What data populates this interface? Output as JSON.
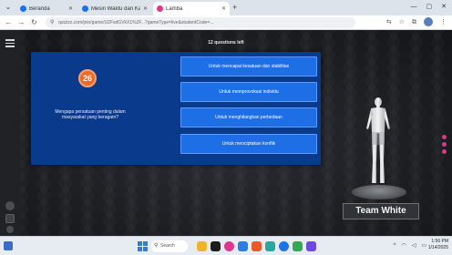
{
  "browser": {
    "tabs": [
      {
        "title": "Beranda",
        "favicon_color": "#1a73e8",
        "active": false
      },
      {
        "title": "Mesin Waktu dan Karang Dasar",
        "favicon_color": "#1a73e8",
        "active": false
      },
      {
        "title": "Lamba",
        "favicon_color": "#e0358c",
        "active": true
      }
    ],
    "new_tab_glyph": "+",
    "window_controls": [
      "—",
      "▢",
      "✕"
    ],
    "url": "quizizz.com/join/game/U2FsdGVkX1%2F...?gameType=live&studentCode=...",
    "nav": {
      "back": "←",
      "forward": "→",
      "reload": "↻"
    }
  },
  "game": {
    "questions_left": "12 questions left",
    "timer": "26",
    "question": "Mengapa persatuan penting dalam masyarakat yang beragam?",
    "answers": [
      "Untuk mencapai kesatuan dan stabilitas",
      "Untuk memprovokasi individu",
      "Untuk menghilangkan perbedaan",
      "Untuk menciptakan konflik"
    ],
    "team_label": "Team White"
  },
  "taskbar": {
    "search_placeholder": "Search",
    "clock_time": "1:56 PM",
    "clock_date": "1/14/2025",
    "app_colors": [
      "#f0b429",
      "#1c1c1c",
      "#e0358c",
      "#2a7de1",
      "#e85a2c",
      "#2aa5a0",
      "#1a73e8",
      "#34a853",
      "#6b4bd8"
    ]
  },
  "colors": {
    "card": "#0a3a8c",
    "answer": "#1e6ee6",
    "timer": "#e86a2c",
    "accent_pink": "#e0358c"
  }
}
